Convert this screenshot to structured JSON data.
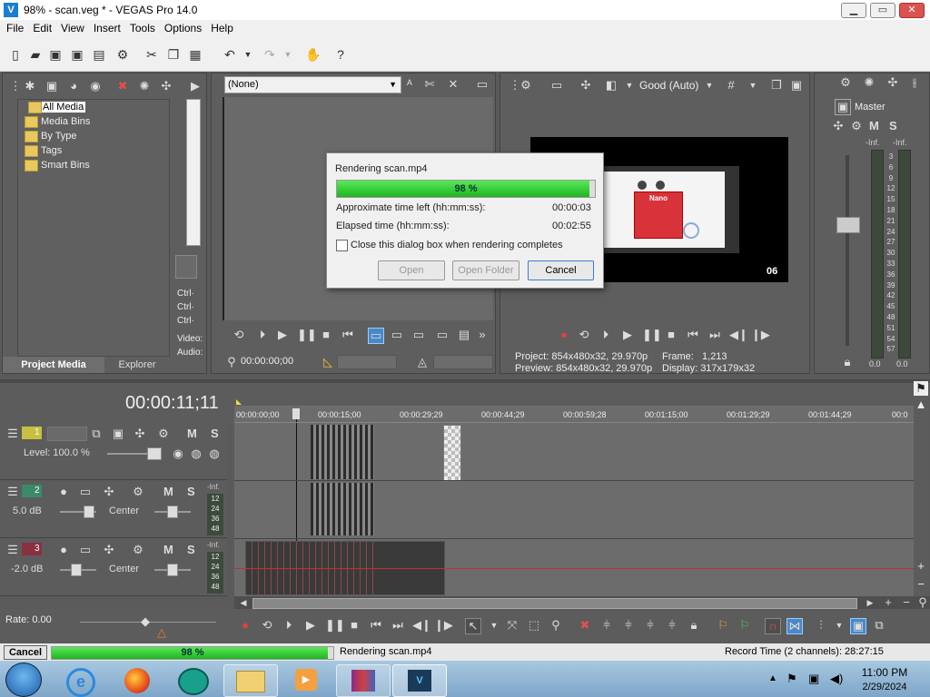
{
  "window": {
    "title": "98% - scan.veg * - VEGAS Pro 14.0",
    "btn_min": "▁",
    "btn_max": "▭",
    "btn_close": "✕"
  },
  "menu": [
    "File",
    "Edit",
    "View",
    "Insert",
    "Tools",
    "Options",
    "Help"
  ],
  "project_media": {
    "items": [
      "All Media",
      "Media Bins",
      "By Type",
      "Tags",
      "Smart Bins"
    ],
    "expander": "+",
    "tabs": {
      "project_media": "Project Media",
      "explorer": "Explorer"
    },
    "side_labels": [
      "Ctrl·",
      "Ctrl·",
      "Ctrl·",
      "Video:",
      "Audio:"
    ]
  },
  "trimmer": {
    "dropdown": "(None)",
    "timecode": "00:00:00;00"
  },
  "preview": {
    "quality": "Good (Auto)",
    "frame_number": "06",
    "project_label": "Project:",
    "project_value": "854x480x32, 29.970p",
    "preview_label": "Preview:",
    "preview_value": "854x480x32, 29.970p",
    "frame_label": "Frame:",
    "frame_value": "1,213",
    "display_label": "Display:",
    "display_value": "317x179x32",
    "thumb_title": "Nano"
  },
  "master": {
    "label": "Master",
    "m": "M",
    "s": "S",
    "inf1": "-Inf.",
    "inf2": "-Inf.",
    "scale": [
      "3",
      "6",
      "9",
      "12",
      "15",
      "18",
      "21",
      "24",
      "27",
      "30",
      "33",
      "36",
      "39",
      "42",
      "45",
      "48",
      "51",
      "54",
      "57"
    ],
    "bottom_left": "0.0",
    "bottom_right": "0.0"
  },
  "dialog": {
    "title": "Rendering scan.mp4",
    "progress_text": "98 %",
    "progress": 0.98,
    "time_left_label": "Approximate time left (hh:mm:ss):",
    "time_left_value": "00:00:03",
    "elapsed_label": "Elapsed time (hh:mm:ss):",
    "elapsed_value": "00:02:55",
    "checkbox_label": "Close this dialog box when rendering completes",
    "open": "Open",
    "open_folder": "Open Folder",
    "cancel": "Cancel"
  },
  "timeline": {
    "current_time": "00:00:11;11",
    "ruler": [
      "00:00:00;00",
      "00:00:15;00",
      "00:00:29;29",
      "00:00:44;29",
      "00:00:59;28",
      "00:01:15;00",
      "00:01:29;29",
      "00:01:44;29",
      "00:0"
    ],
    "tracks": [
      {
        "num": "1",
        "level": "Level: 100.0 %",
        "m": "M",
        "s": "S"
      },
      {
        "num": "2",
        "db": "5.0 dB",
        "pan": "Center",
        "m": "M",
        "s": "S",
        "inf": "-Inf.",
        "meter": [
          "12",
          "24",
          "36",
          "48"
        ]
      },
      {
        "num": "3",
        "db": "-2.0 dB",
        "pan": "Center",
        "m": "M",
        "s": "S",
        "inf": "-Inf.",
        "meter": [
          "12",
          "24",
          "36",
          "48"
        ]
      }
    ],
    "rate": "Rate: 0.00"
  },
  "status": {
    "cancel": "Cancel",
    "progress_text": "98 %",
    "progress": 0.98,
    "rendering": "Rendering scan.mp4",
    "record_time": "Record Time (2 channels): 28:27:15"
  },
  "taskbar": {
    "time": "11:00 PM",
    "date": "2/29/2024"
  }
}
